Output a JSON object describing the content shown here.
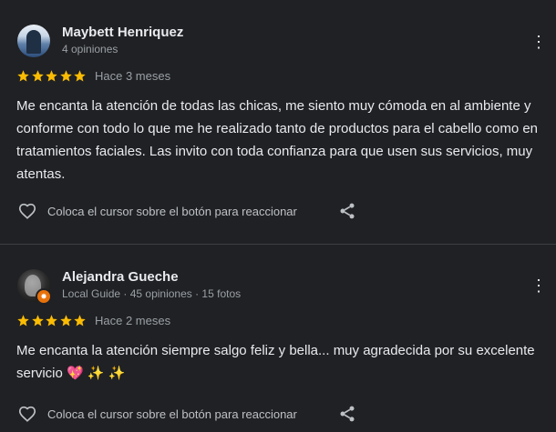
{
  "reviews": [
    {
      "author": "Maybett Henriquez",
      "meta": "4 opiniones",
      "rating": 5,
      "when": "Hace 3 meses",
      "text": "Me encanta la atención de todas las chicas, me siento muy cómoda en al ambiente y conforme con todo lo que me he realizado tanto de productos para el cabello como en tratamientos faciales. Las invito con toda confianza para que usen sus servicios, muy atentas.",
      "react_label": "Coloca el cursor sobre el botón para reaccionar"
    },
    {
      "author": "Alejandra Gueche",
      "meta": "Local Guide · 45 opiniones · 15 fotos",
      "rating": 5,
      "when": "Hace 2 meses",
      "text": "Me encanta la atención siempre salgo feliz y bella... muy agradecida por su excelente servicio 💖 ✨ ✨",
      "react_label": "Coloca el cursor sobre el botón para reaccionar"
    }
  ],
  "icons": {
    "more": "more-vert-icon",
    "star": "star-icon",
    "heart": "heart-outline-icon",
    "share": "share-icon",
    "badge": "local-guide-badge-icon"
  },
  "colors": {
    "background": "#202124",
    "star": "#fbbc04",
    "text": "#e8eaed",
    "secondary": "#9aa0a6",
    "badge": "#e8710a"
  }
}
